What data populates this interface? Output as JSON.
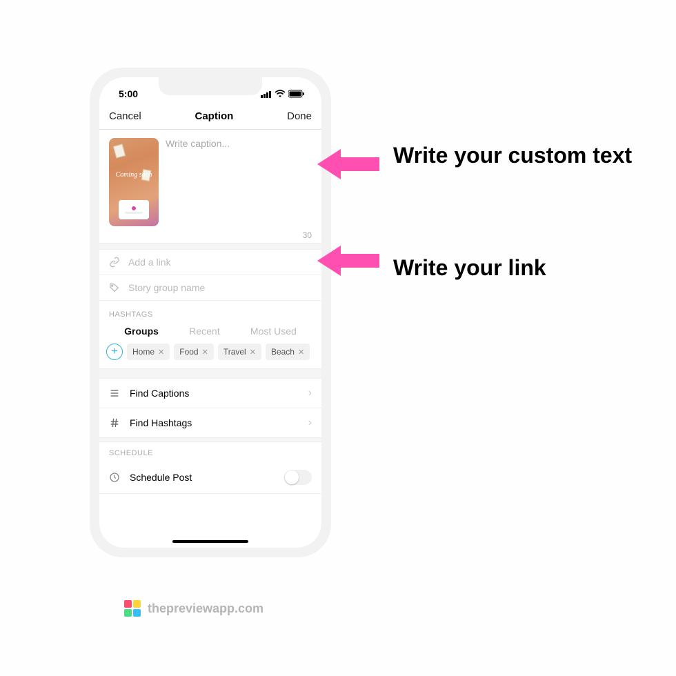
{
  "status": {
    "time": "5:00"
  },
  "nav": {
    "cancel": "Cancel",
    "title": "Caption",
    "done": "Done"
  },
  "caption": {
    "placeholder": "Write caption...",
    "char_count": "30",
    "thumb_overlay": "Coming soon"
  },
  "links": {
    "link_placeholder": "Add a link",
    "group_placeholder": "Story group name"
  },
  "hashtags": {
    "section_label": "HASHTAGS",
    "tabs": {
      "groups": "Groups",
      "recent": "Recent",
      "most_used": "Most Used"
    },
    "chips": [
      "Home",
      "Food",
      "Travel",
      "Beach"
    ]
  },
  "actions": {
    "find_captions": "Find Captions",
    "find_hashtags": "Find Hashtags"
  },
  "schedule": {
    "section_label": "SCHEDULE",
    "schedule_post": "Schedule Post"
  },
  "annotations": {
    "custom_text": "Write your custom text",
    "link_text": "Write your link"
  },
  "footer": {
    "credit": "thepreviewapp.com"
  }
}
